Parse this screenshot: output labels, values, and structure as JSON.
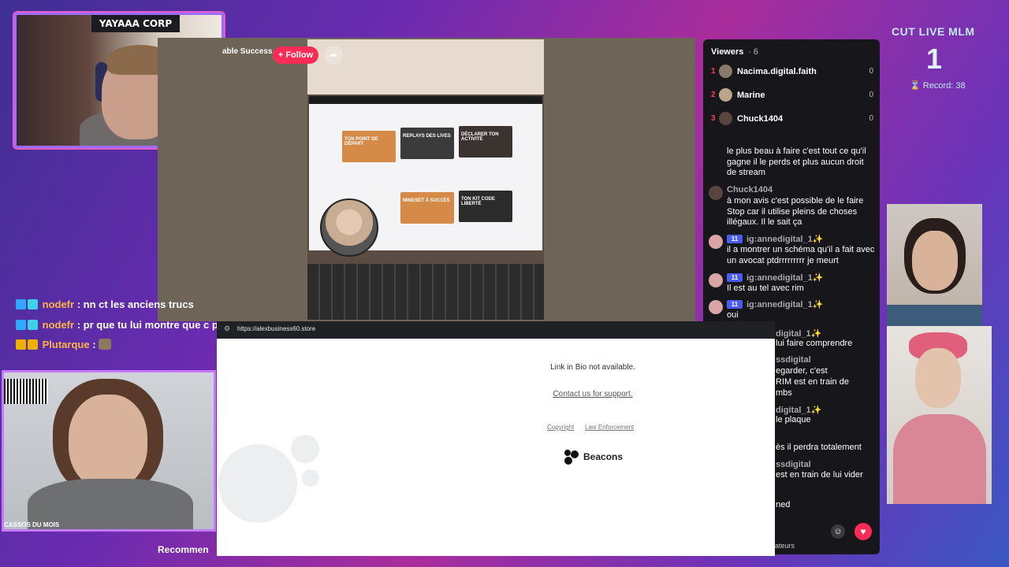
{
  "streamer_cam": {
    "label": "YAYAAA CORP",
    "stars": "× × × ×"
  },
  "live": {
    "title": "able Success...",
    "follow_label": "+ Follow",
    "share_icon": "share-icon"
  },
  "laptop_tiles": [
    {
      "label": "TON POINT DE DÉPART",
      "color": "#d68a48"
    },
    {
      "label": "REPLAYS DES LIVES",
      "color": "#3b3b3b"
    },
    {
      "label": "DÉCLARER TON ACTIVITÉ",
      "color": "#3a3330"
    },
    {
      "label": "MINDSET À SUCCÈS",
      "color": "#d68a48"
    },
    {
      "label": "TON KIT CODE LIBERTÉ",
      "color": "#2b2b2b"
    }
  ],
  "viewers": {
    "header": "Viewers",
    "count": "· 6",
    "list": [
      {
        "rank": "1",
        "name": "Nacima.digital.faith",
        "score": "0"
      },
      {
        "rank": "2",
        "name": "Marine",
        "score": "0"
      },
      {
        "rank": "3",
        "name": "Chuck1404",
        "score": "0"
      }
    ]
  },
  "chat": [
    {
      "user": "",
      "badge": "",
      "text": "le plus beau à faire c'est tout ce qu'il gagne il le perds et plus aucun droit de stream"
    },
    {
      "user": "Chuck1404",
      "badge": "",
      "text": "à mon avis c'est possible de le faire Stop car il utilise pleins de choses illégaux. Il le sait ça"
    },
    {
      "user": "ig:annedigital_1✨",
      "badge": "11",
      "text": "il a montrer un schéma qu'il a fait avec un avocat ptdrrrrrrrrr je meurt"
    },
    {
      "user": "ig:annedigital_1✨",
      "badge": "11",
      "text": "Il est au tel avec rim"
    },
    {
      "user": "ig:annedigital_1✨",
      "badge": "11",
      "text": "oui"
    }
  ],
  "chat_hidden_fragments": [
    "digital_1✨",
    "lui faire comprendre",
    "ssdigital",
    "egarder, c'est",
    "RIM est en train de",
    "mbs",
    "digital_1✨",
    "le plaque",
    "ès il perdra totalement",
    "ssdigital",
    "est en train de lui vider",
    "ned"
  ],
  "counter": {
    "title": "CUT LIVE MLM",
    "number": "1",
    "record": "⌛ Record: 38"
  },
  "twitch_chat": [
    {
      "user": "nodefr",
      "text": ": nn ct les anciens trucs"
    },
    {
      "user": "nodefr",
      "text": ": pr que tu lui montre que c pos"
    },
    {
      "user": "Plutarque",
      "text": ":"
    }
  ],
  "cam_bottom_label": "CASSOS DU MOIS",
  "browser": {
    "url": "https://alexbusiness60.store",
    "bio_message": "Link in Bio not available.",
    "support_link": "Contact us for support.",
    "copyright": "Copyright",
    "law": "Law Enforcement",
    "brand": "Beacons"
  },
  "recommend": "Recommen",
  "viewers_footer": "ateurs",
  "colors": {
    "follow": "#fe2c55",
    "rank": "#ff3b5c",
    "counter": "#bfe9ff",
    "frame": "#9d6bff"
  }
}
